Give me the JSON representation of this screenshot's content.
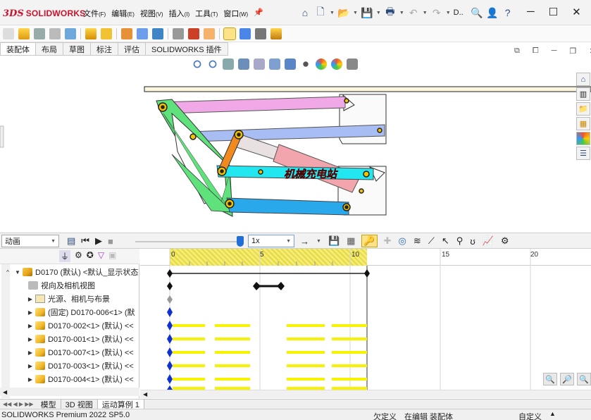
{
  "app": {
    "logo_mark": "3DS",
    "logo_text": "SOLIDWORKS",
    "title_short": "D.."
  },
  "menu": [
    {
      "label": "文件",
      "key": "(F)"
    },
    {
      "label": "编辑",
      "key": "(E)"
    },
    {
      "label": "视图",
      "key": "(V)"
    },
    {
      "label": "插入",
      "key": "(I)"
    },
    {
      "label": "工具",
      "key": "(T)"
    },
    {
      "label": "窗口",
      "key": "(W)"
    }
  ],
  "cmd_tabs": [
    "装配体",
    "布局",
    "草图",
    "标注",
    "评估",
    "SOLIDWORKS 插件"
  ],
  "model": {
    "watermark": "机械充电站"
  },
  "motion": {
    "study_type": "动画",
    "speed": "1x",
    "ticks": [
      "0",
      "5",
      "10",
      "15",
      "20"
    ]
  },
  "tree": [
    {
      "label": "D0170 (默认) <默认_显示状态",
      "icon": "assembly-icon",
      "arrow": "▼",
      "indent": 0
    },
    {
      "label": "视向及相机视图",
      "icon": "camera-view-icon",
      "arrow": "",
      "indent": 1
    },
    {
      "label": "光源、相机与布景",
      "icon": "lights-cameras-icon",
      "arrow": "▶",
      "indent": 1
    },
    {
      "label": "(固定) D0170-006<1> (默",
      "icon": "part-icon",
      "arrow": "▶",
      "indent": 1
    },
    {
      "label": "D0170-002<1> (默认) <<",
      "icon": "part-icon",
      "arrow": "▶",
      "indent": 1
    },
    {
      "label": "D0170-001<1> (默认) <<",
      "icon": "part-icon",
      "arrow": "▶",
      "indent": 1
    },
    {
      "label": "D0170-007<1> (默认) <<",
      "icon": "part-icon",
      "arrow": "▶",
      "indent": 1
    },
    {
      "label": "D0170-003<1> (默认) <<",
      "icon": "part-icon",
      "arrow": "▶",
      "indent": 1
    },
    {
      "label": "D0170-004<1> (默认) <<",
      "icon": "part-icon",
      "arrow": "▶",
      "indent": 1
    }
  ],
  "bottom_tabs": [
    "模型",
    "3D 视图",
    "运动算例 1"
  ],
  "status": {
    "product": "SOLIDWORKS Premium 2022 SP5.0",
    "underdefined": "欠定义",
    "editing": "在编辑 装配体",
    "custom": "自定义"
  },
  "colors": {
    "pink_link": "#f0a8e6",
    "blue_link": "#a9bdf5",
    "cyan_link": "#22e6f0",
    "green_link": "#5fe27c",
    "sky_link": "#29a8ec",
    "orange_link": "#f08a1e",
    "cylinder": "#f2a5ad",
    "accent": "#1f6fd6",
    "key_yellow": "#f7f200"
  }
}
